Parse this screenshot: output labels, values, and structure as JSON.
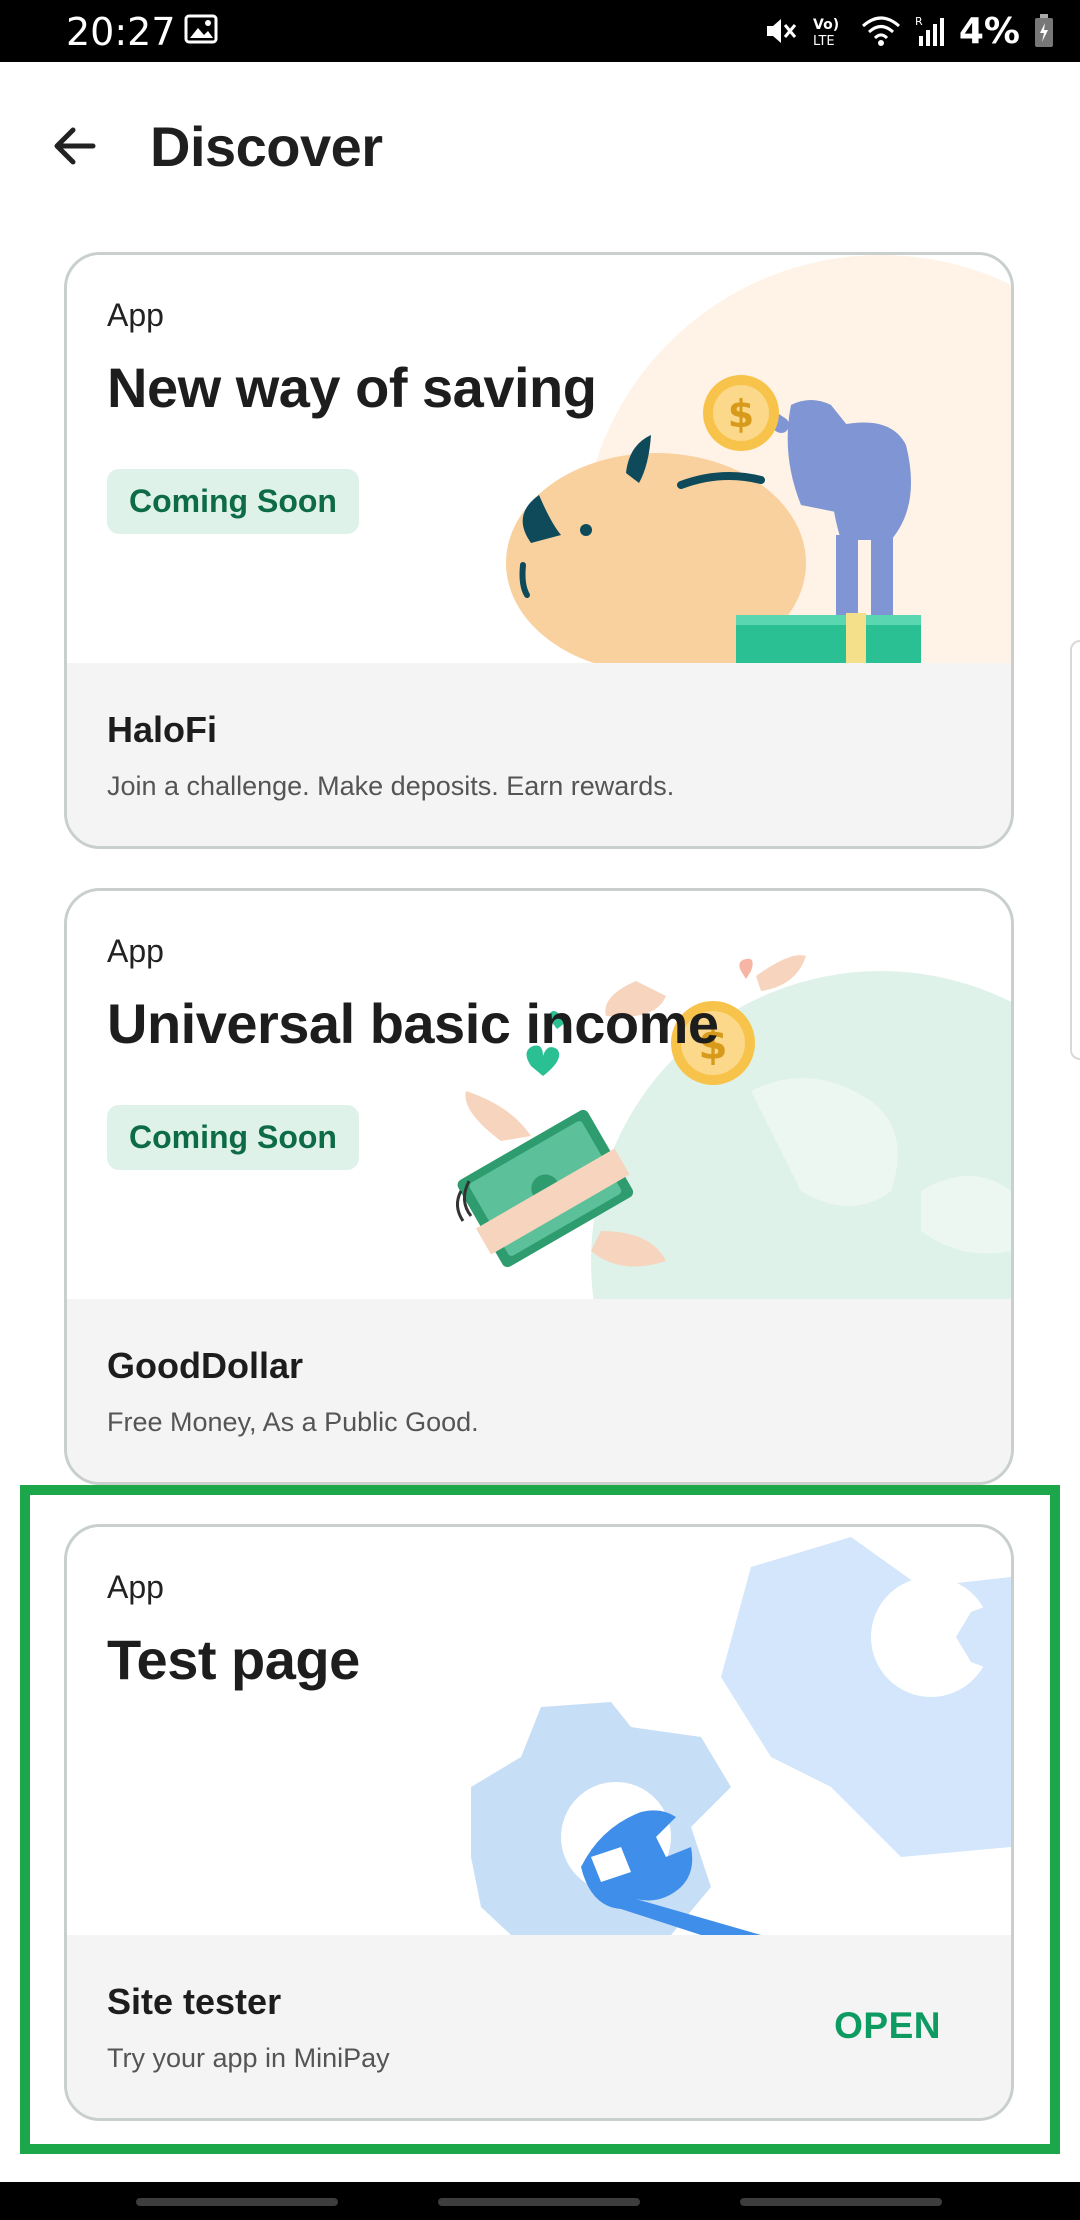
{
  "status_bar": {
    "time": "20:27",
    "battery": "4%",
    "icons": [
      "gallery-icon",
      "mute-icon",
      "volte-icon",
      "wifi-icon",
      "signal-icon",
      "battery-icon"
    ]
  },
  "header": {
    "title": "Discover",
    "back_icon": "arrow-left-icon"
  },
  "cards": [
    {
      "type": "App",
      "title": "New way of saving",
      "badge": "Coming Soon",
      "app_name": "HaloFi",
      "description": "Join a challenge. Make deposits. Earn rewards.",
      "illustration": "piggy-bank-icon"
    },
    {
      "type": "App",
      "title": "Universal basic income",
      "badge": "Coming Soon",
      "app_name": "GoodDollar",
      "description": "Free Money, As a Public Good.",
      "illustration": "flying-money-icon"
    },
    {
      "type": "App",
      "title": "Test page",
      "app_name": "Site tester",
      "description": "Try your app in MiniPay",
      "action": "OPEN",
      "illustration": "gear-wrench-icon"
    }
  ],
  "colors": {
    "accent_green": "#0d9b62",
    "badge_bg": "#dff2ea",
    "badge_text": "#0e6b47",
    "highlight": "#1ca84a"
  }
}
